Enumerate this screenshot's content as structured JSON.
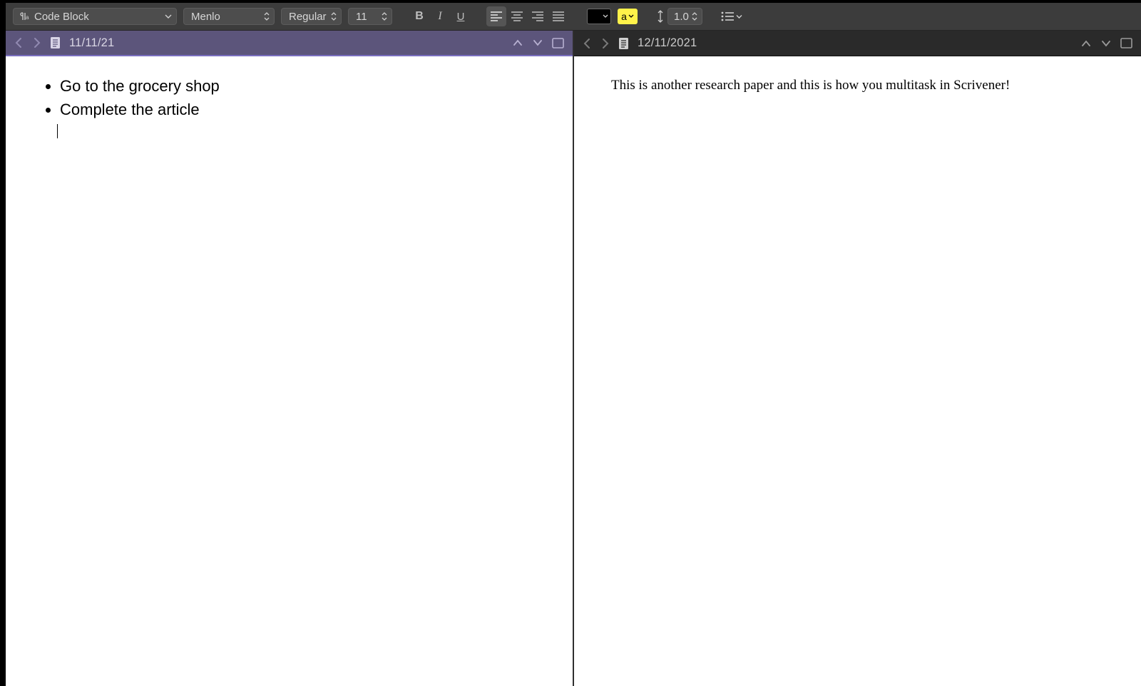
{
  "toolbar": {
    "paragraph_style": "Code Block",
    "font_family": "Menlo",
    "font_style": "Regular",
    "font_size": "11",
    "line_spacing": "1.0",
    "text_color": "#000000",
    "highlight_color": "#fff24a",
    "highlight_label": "a"
  },
  "panes": {
    "left": {
      "title": "11/11/21",
      "bullets": [
        "Go to the grocery shop",
        "Complete the article"
      ]
    },
    "right": {
      "title": "12/11/2021",
      "body": "This is another research paper and this is how you multitask in Scrivener!"
    }
  }
}
